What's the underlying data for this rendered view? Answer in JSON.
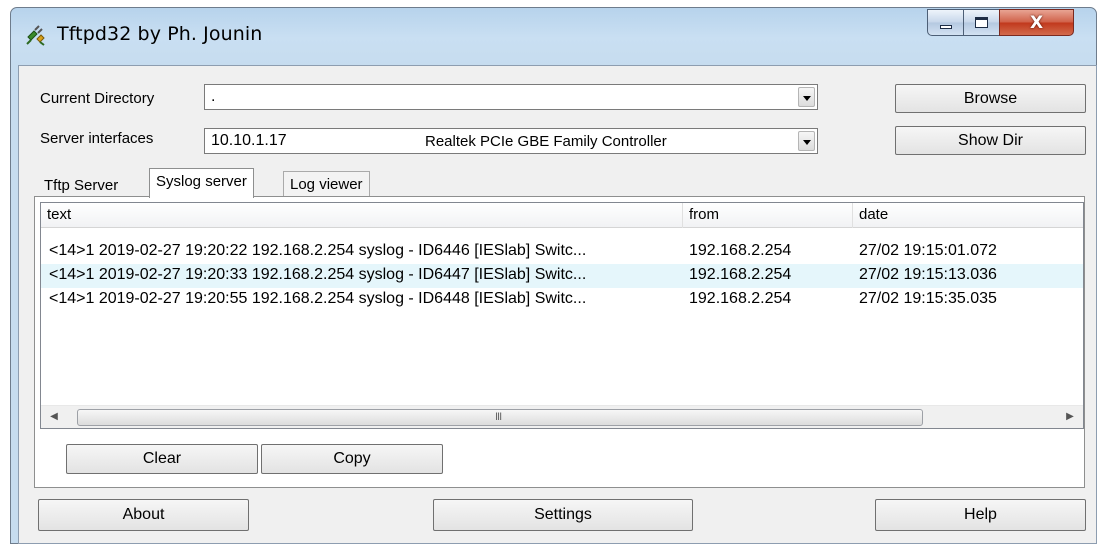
{
  "window": {
    "title": "Tftpd32 by Ph. Jounin",
    "app_icon": "network-plug-icon"
  },
  "caption_buttons": {
    "minimize": "minimize-icon",
    "maximize": "maximize-icon",
    "close_glyph": "X"
  },
  "current_directory": {
    "label": "Current Directory",
    "value": "."
  },
  "server_interfaces": {
    "label": "Server interfaces",
    "ip": "10.10.1.17",
    "adapter": "Realtek PCIe GBE Family Controller"
  },
  "buttons": {
    "browse": "Browse",
    "show_dir": "Show Dir",
    "clear": "Clear",
    "copy": "Copy",
    "about": "About",
    "settings": "Settings",
    "help": "Help"
  },
  "tabs": [
    {
      "label": "Tftp Server",
      "active": false
    },
    {
      "label": "Syslog server",
      "active": true
    },
    {
      "label": "Log viewer",
      "active": false
    }
  ],
  "syslog_list": {
    "columns": [
      "text",
      "from",
      "date"
    ],
    "rows": [
      {
        "text": "<14>1 2019-02-27 19:20:22 192.168.2.254 syslog - ID6446 [IESlab] Switc...",
        "from": "192.168.2.254",
        "date": "27/02 19:15:01.072",
        "selected": false
      },
      {
        "text": "<14>1 2019-02-27 19:20:33 192.168.2.254 syslog - ID6447 [IESlab] Switc...",
        "from": "192.168.2.254",
        "date": "27/02 19:15:13.036",
        "selected": true
      },
      {
        "text": "<14>1 2019-02-27 19:20:55 192.168.2.254 syslog - ID6448 [IESlab] Switc...",
        "from": "192.168.2.254",
        "date": "27/02 19:15:35.035",
        "selected": false
      }
    ],
    "scroll_grip": "III"
  },
  "colors": {
    "selected_row": "#e5f6fb",
    "title_bar": "#c6dcef",
    "close_button": "#c1391d"
  }
}
